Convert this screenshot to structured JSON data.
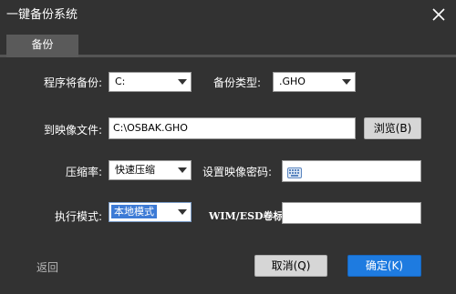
{
  "window": {
    "title": "一键备份系统",
    "close_icon": "close-icon"
  },
  "tabs": [
    {
      "label": "备份"
    }
  ],
  "form": {
    "source_label": "程序将备份:",
    "source_value": "C:",
    "backup_type_label": "备份类型:",
    "backup_type_value": ".GHO",
    "image_file_label": "到映像文件:",
    "image_file_value": "C:\\OSBAK.GHO",
    "browse_label": "浏览(B)",
    "compression_label": "压缩率:",
    "compression_value": "快速压缩",
    "password_label": "设置映像密码:",
    "password_value": "",
    "mode_label": "执行模式:",
    "mode_value": "本地模式",
    "wim_label": "WIM/ESD卷标:",
    "wim_value": ""
  },
  "footer": {
    "back_label": "返回",
    "cancel_label": "取消(Q)",
    "ok_label": "确定(K)"
  },
  "colors": {
    "background": "#323232",
    "accent": "#1e7be0",
    "tab": "#5a5a5a"
  }
}
